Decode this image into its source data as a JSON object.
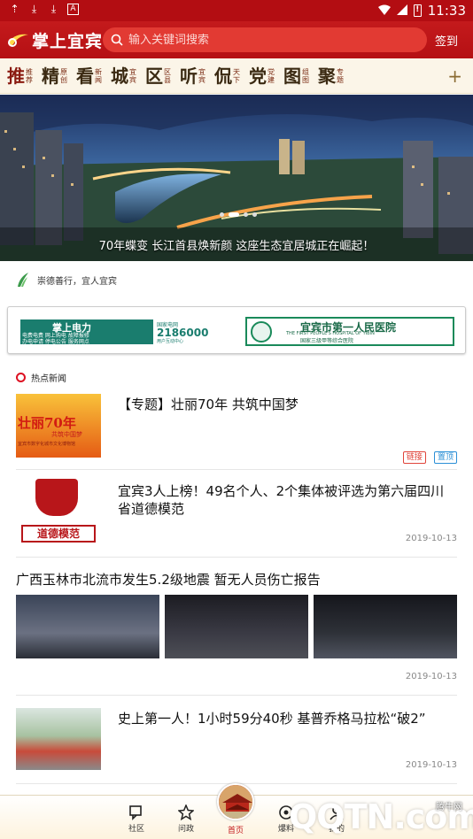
{
  "statusbar": {
    "time": "11:33",
    "battery": "!"
  },
  "header": {
    "logo_text": "掌上宜宾",
    "search_placeholder": "输入关键词搜索",
    "signin": "签到"
  },
  "channels": [
    {
      "big": "推",
      "small": "推荐"
    },
    {
      "big": "精",
      "small": "原创"
    },
    {
      "big": "看",
      "small": "新闻"
    },
    {
      "big": "城",
      "small": "宜宾"
    },
    {
      "big": "区",
      "small": "区县"
    },
    {
      "big": "听",
      "small": "宜宾"
    },
    {
      "big": "侃",
      "small": "天下"
    },
    {
      "big": "党",
      "small": "党建"
    },
    {
      "big": "图",
      "small": "组图"
    },
    {
      "big": "聚",
      "small": "专题"
    }
  ],
  "banner": {
    "caption": "70年蝶变 长江首县焕新颜 这座生态宜居城正在崛起！"
  },
  "slogan": "崇德善行，宜人宜宾",
  "ads": {
    "ad1_title": "掌上电力",
    "ad1_phone": "2186000",
    "ad1_sub": "用户互动中心",
    "ad1_line1": "电费电费 网上购电 故障报修",
    "ad1_line2": "办电申请 停电公告 服务网点",
    "ad1_brand": "国家电网",
    "ad2_title": "宜宾市第一人民医院",
    "ad2_en": "THE FIRST PEOPLE'S HOSPITAL OF YIBIN",
    "ad2_sub": "国家三级甲等综合医院"
  },
  "section_title": "热点新闻",
  "news": [
    {
      "title": "【专题】壮丽70年 共筑中国梦",
      "tags": [
        "链接",
        "置顶"
      ],
      "thumb_text": "壮丽70年",
      "thumb_sub": "共筑中国梦",
      "thumb_caption": "宜宾市数字化城市文化博物馆"
    },
    {
      "title": "宜宾3人上榜！49名个人、2个集体被评选为第六届四川省道德模范",
      "date": "2019-10-13",
      "thumb_text": "道德模范"
    },
    {
      "title": "广西玉林市北流市发生5.2级地震 暂无人员伤亡报告",
      "date": "2019-10-13"
    },
    {
      "title": "史上第一人！1小时59分40秒 基普乔格马拉松“破2”",
      "date": "2019-10-13"
    }
  ],
  "bottomnav": [
    {
      "label": "社区",
      "icon": "community-icon"
    },
    {
      "label": "问政",
      "icon": "star-icon"
    },
    {
      "label": "首页",
      "icon": "home-icon"
    },
    {
      "label": "爆料",
      "icon": "report-icon"
    },
    {
      "label": "我的",
      "icon": "profile-icon"
    }
  ],
  "watermark": {
    "logo": "QQTN.com",
    "site": "腾牛网"
  },
  "colors": {
    "brand_red": "#c41a1c",
    "tag_red": "#e0443a",
    "tag_blue": "#2a8fd6"
  }
}
